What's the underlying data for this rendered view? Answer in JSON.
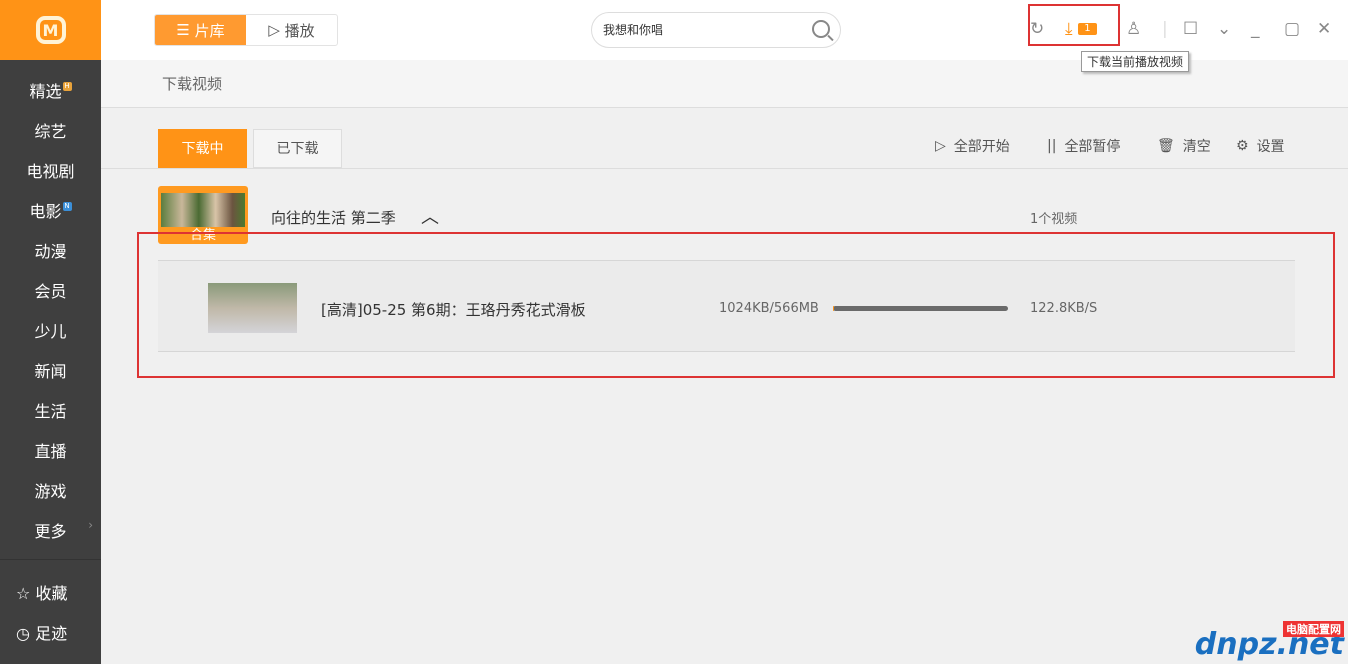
{
  "sidebar": {
    "logo": "M",
    "items": [
      {
        "label": "精选",
        "badge": "H",
        "badge_color": "#e8a23a"
      },
      {
        "label": "综艺"
      },
      {
        "label": "电视剧"
      },
      {
        "label": "电影",
        "badge": "N",
        "badge_color": "#3b8fd8"
      },
      {
        "label": "动漫"
      },
      {
        "label": "会员"
      },
      {
        "label": "少儿"
      },
      {
        "label": "新闻"
      },
      {
        "label": "生活"
      },
      {
        "label": "直播"
      },
      {
        "label": "游戏"
      },
      {
        "label": "更多"
      }
    ],
    "bottom": [
      {
        "label": "收藏",
        "icon": "star-icon"
      },
      {
        "label": "足迹",
        "icon": "clock-icon"
      }
    ]
  },
  "header": {
    "segments": [
      "片库",
      "播放"
    ],
    "search_value": "我想和你唱",
    "download_badge": "1",
    "tooltip": "下载当前播放视频"
  },
  "breadcrumb": "下载视频",
  "tabs": [
    "下载中",
    "已下载"
  ],
  "actions": [
    "全部开始",
    "全部暂停",
    "清空",
    "设置"
  ],
  "group": {
    "folder_label": "合集",
    "title": "向往的生活 第二季",
    "count": "1个视频"
  },
  "item": {
    "title": "[高清]05-25 第6期：王珞丹秀花式滑板",
    "size": "1024KB/566MB",
    "progress_percent": 0.2,
    "speed": "122.8KB/S"
  },
  "watermark": {
    "text": "dnpz.net",
    "tag": "电脑配置网"
  },
  "colors": {
    "accent": "#ff9316",
    "sidebar": "#3f3f3f",
    "highlight_box": "#d33333"
  }
}
